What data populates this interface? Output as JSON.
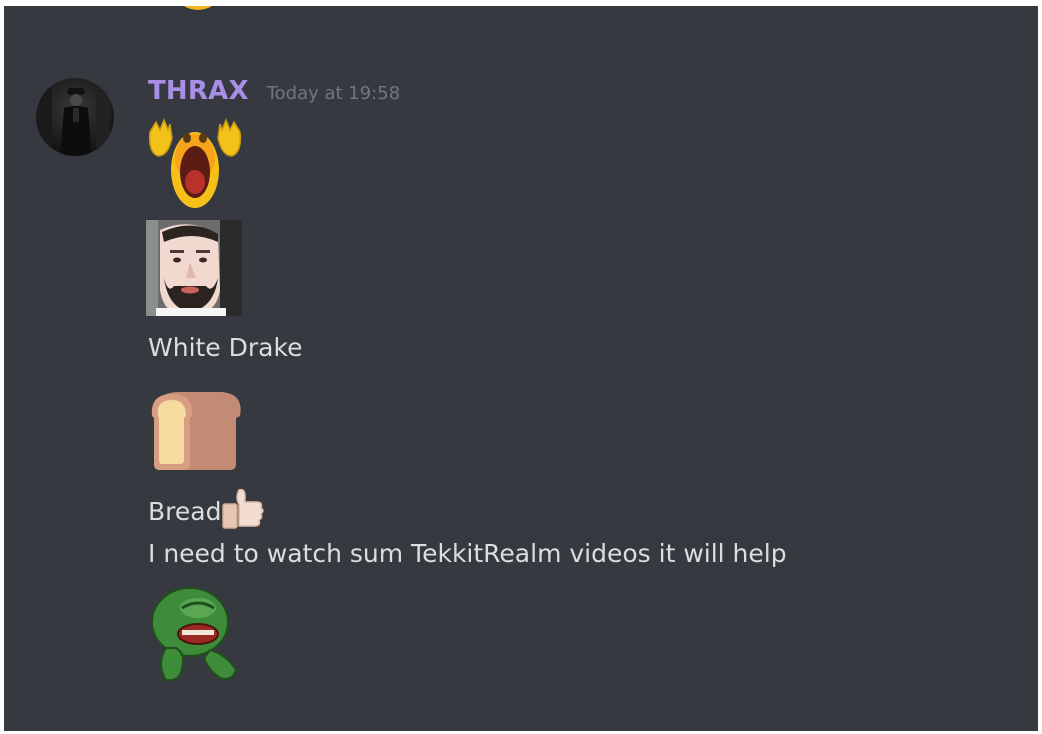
{
  "message": {
    "author": "THRAX",
    "timestamp": "Today at 19:58",
    "lines": [
      "White Drake",
      "Bread",
      "I need to watch sum TekkitRealm videos it will help"
    ]
  },
  "emojis": {
    "top_partial": "partial-emoji-icon",
    "screaming": "screaming-face-emoji",
    "drake_face": "white-drake-custom-emoji",
    "bread": "bread-emoji",
    "thumbs_up": "thumbs-up-emoji",
    "pepe": "crying-pepe-custom-emoji"
  },
  "colors": {
    "background": "#36393f",
    "username": "#a98ee6",
    "timestamp": "#72767d",
    "text": "#dcddde"
  }
}
